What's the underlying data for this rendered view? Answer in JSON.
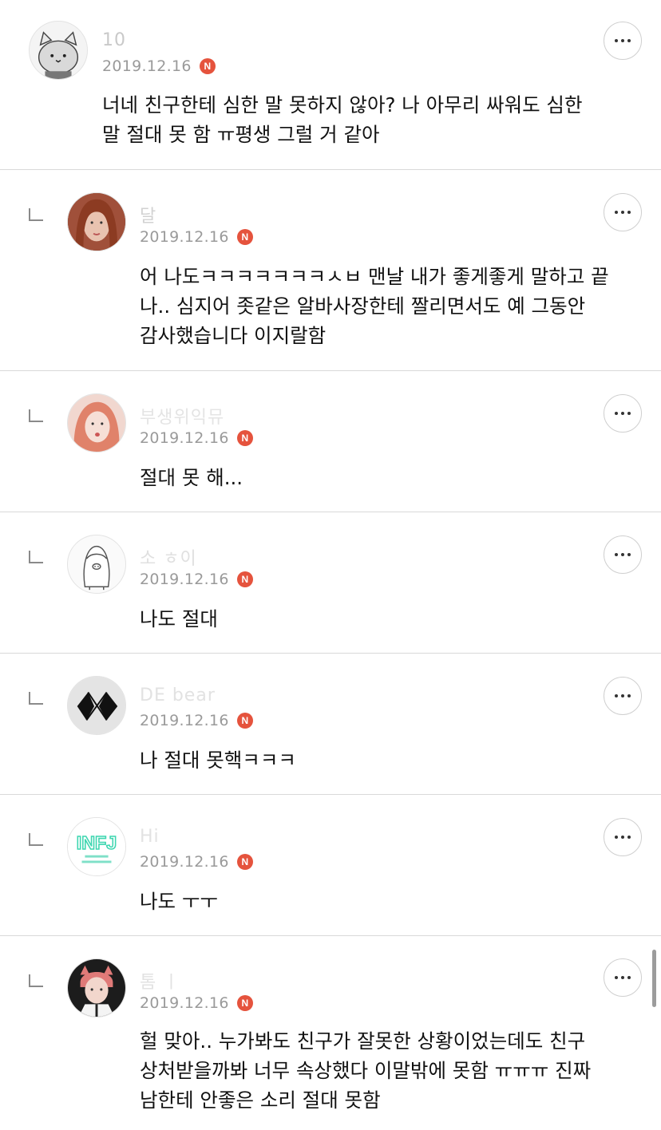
{
  "comments": [
    {
      "nickname": "10",
      "date": "2019.12.16",
      "badge": "N",
      "text": "너네 친구한테 심한 말 못하지 않아? 나 아무리 싸워도 심한\n말 절대 못 함 ㅠ평생 그럴 거 같아",
      "reply": false
    },
    {
      "nickname": "달",
      "date": "2019.12.16",
      "badge": "N",
      "text": "어 나도ㅋㅋㅋㅋㅋㅋㅋㅅㅂ 맨날 내가 좋게좋게 말하고 끝\n나.. 심지어 좃같은 알바사장한테 짤리면서도 예 그동안\n감사했습니다 이지랄함",
      "reply": true
    },
    {
      "nickname": "부생위익뮤",
      "date": "2019.12.16",
      "badge": "N",
      "text": "절대 못 해...",
      "reply": true
    },
    {
      "nickname": "소  ㅎ이",
      "date": "2019.12.16",
      "badge": "N",
      "text": "나도 절대",
      "reply": true
    },
    {
      "nickname": "DE      bear",
      "date": "2019.12.16",
      "badge": "N",
      "text": "나 절대 못핵ㅋㅋㅋ",
      "reply": true
    },
    {
      "nickname": "Hi",
      "date": "2019.12.16",
      "badge": "N",
      "text": "나도 ㅜㅜ",
      "reply": true,
      "avatar_text": "INFJ"
    },
    {
      "nickname": "톰  ㅣ",
      "date": "2019.12.16",
      "badge": "N",
      "text": "헐 맞아.. 누가봐도 친구가 잘못한 상황이었는데도 친구\n상처받을까봐 너무 속상했다 이말밖에 못함 ㅠㅠㅠ 진짜\n남한테 안좋은 소리 절대 못함",
      "reply": true
    }
  ],
  "colors": {
    "badge": "#e5533d",
    "date": "#9a9a9a",
    "divider": "#d9d9d9"
  }
}
